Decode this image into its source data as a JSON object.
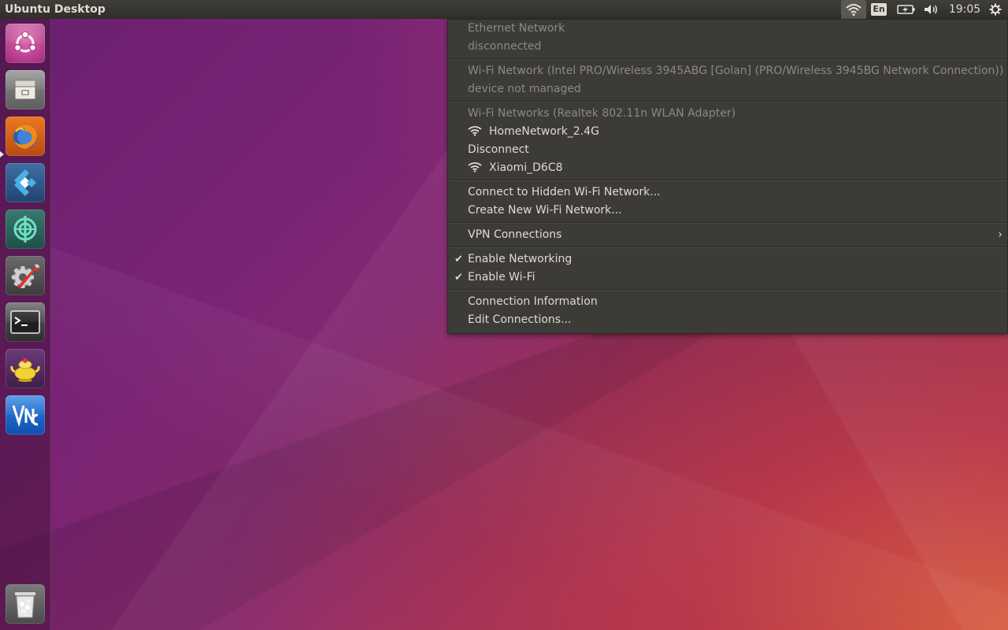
{
  "panel": {
    "title": "Ubuntu Desktop",
    "language": "En",
    "clock": "19:05"
  },
  "launcher": {
    "items": [
      {
        "name": "dash-home",
        "icon": "ubuntu-logo-icon"
      },
      {
        "name": "files",
        "icon": "file-cabinet-icon"
      },
      {
        "name": "firefox",
        "icon": "firefox-icon",
        "running": true
      },
      {
        "name": "kodi",
        "icon": "kodi-icon"
      },
      {
        "name": "teamviewer",
        "icon": "crosshair-app-icon"
      },
      {
        "name": "system-settings",
        "icon": "settings-wrench-icon"
      },
      {
        "name": "terminal",
        "icon": "terminal-icon"
      },
      {
        "name": "genie",
        "icon": "teapot-icon"
      },
      {
        "name": "vnc-viewer",
        "icon": "vnc-icon"
      },
      {
        "name": "trash",
        "icon": "trash-icon"
      }
    ]
  },
  "network_menu": {
    "ethernet_header": "Ethernet Network",
    "ethernet_status": "disconnected",
    "wifi1_header": "Wi-Fi Network (Intel PRO/Wireless 3945ABG [Golan] (PRO/Wireless 3945BG Network Connection))",
    "wifi1_status": "device not managed",
    "wifi2_header": "Wi-Fi Networks (Realtek 802.11n WLAN Adapter)",
    "network1": "HomeNetwork_2.4G",
    "disconnect": "Disconnect",
    "network2": "Xiaomi_D6C8",
    "connect_hidden": "Connect to Hidden Wi-Fi Network...",
    "create_new": "Create New Wi-Fi Network...",
    "vpn": "VPN Connections",
    "enable_networking": "Enable Networking",
    "enable_wifi": "Enable Wi-Fi",
    "connection_info": "Connection Information",
    "edit_connections": "Edit Connections..."
  }
}
